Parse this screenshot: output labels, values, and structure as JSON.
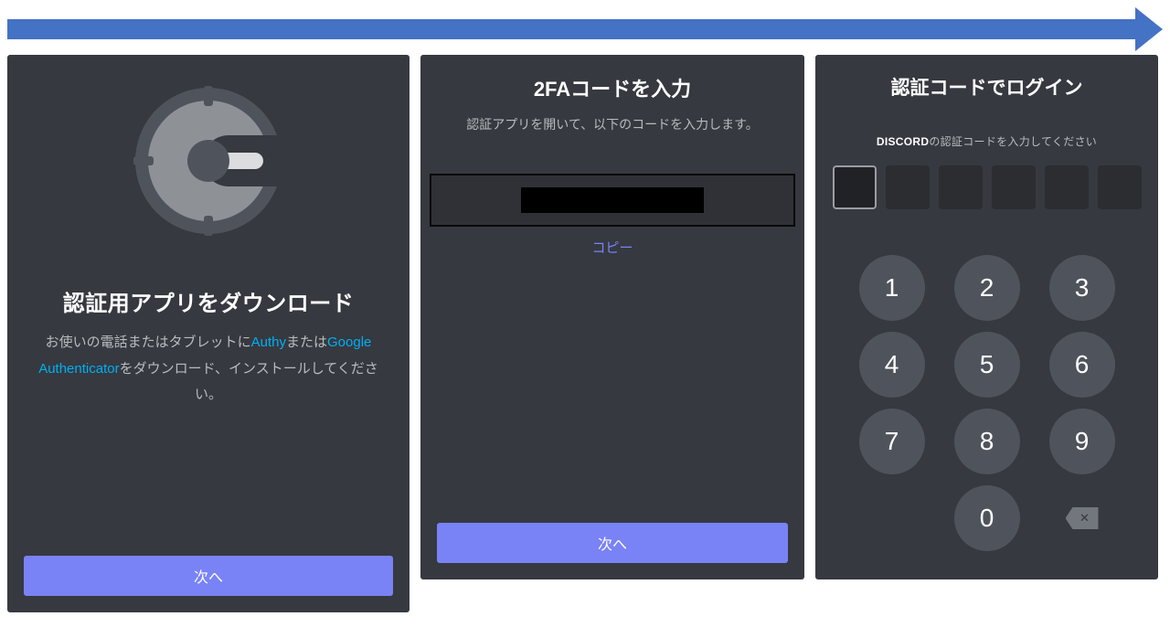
{
  "flow": {
    "direction": "right"
  },
  "panel1": {
    "title": "認証用アプリをダウンロード",
    "desc_pre": "お使いの電話またはタブレットに",
    "link_authy": "Authy",
    "desc_mid": "または",
    "link_ga": "Google Authenticator",
    "desc_post": "をダウンロード、インストールしてください。",
    "next": "次へ",
    "icon_name": "google-authenticator"
  },
  "panel2": {
    "title": "2FAコードを入力",
    "subtitle": "認証アプリを開いて、以下のコードを入力します。",
    "code_value_redacted": true,
    "copy_label": "コピー",
    "next": "次へ"
  },
  "panel3": {
    "title": "認証コードでログイン",
    "sub_brand": "DISCORD",
    "sub_rest": "の認証コードを入力してください",
    "digit_count": 6,
    "active_digit_index": 0,
    "keypad": [
      "1",
      "2",
      "3",
      "4",
      "5",
      "6",
      "7",
      "8",
      "9",
      "",
      "0",
      "backspace"
    ]
  },
  "colors": {
    "bg_panel": "#36393f",
    "primary": "#7983f5",
    "arrow": "#4472c4",
    "link": "#00aff4"
  }
}
